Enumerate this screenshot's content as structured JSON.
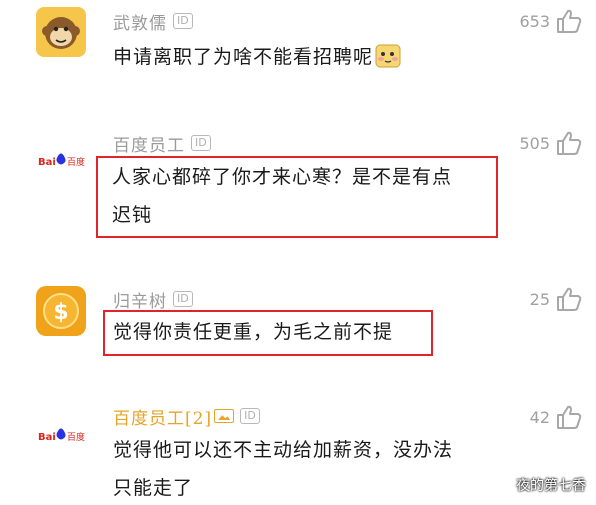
{
  "comments": [
    {
      "username": "武敦儒",
      "id_badge": "ID",
      "likes": "653",
      "text": "申请离职了为啥不能看招聘呢",
      "avatar": "monkey-face-icon",
      "emoji": "embarrassed-emoji-icon"
    },
    {
      "username": "百度员工",
      "id_badge": "ID",
      "likes": "505",
      "text_line1": "人家心都碎了你才来心寒？是不是有点",
      "text_line2": "迟钝",
      "avatar": "baidu-logo-icon",
      "avatar_text": "Bai百度"
    },
    {
      "username": "归辛树",
      "id_badge": "ID",
      "likes": "25",
      "text": "觉得你责任更重，为毛之前不提",
      "avatar": "dollar-coin-icon"
    },
    {
      "username": "百度员工[2]",
      "id_badge": "ID",
      "likes": "42",
      "text_line1": "觉得他可以还不主动给加薪资，没办法",
      "text_line2": "只能走了",
      "avatar": "baidu-logo-icon",
      "avatar_text": "Bai百度",
      "vip_badge": "vip-crown-icon"
    }
  ],
  "watermark": "夜的第七香",
  "colors": {
    "highlight": "#e0242a",
    "vip_name": "#e6a428",
    "muted": "#9a9a9a"
  }
}
